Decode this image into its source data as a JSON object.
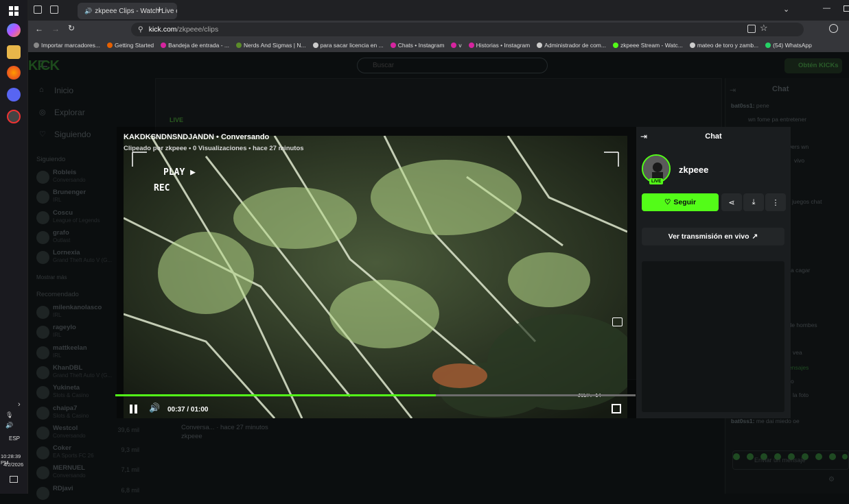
{
  "browser": {
    "tab_title": "zkpeee Clips - Watch Live o",
    "url": "kick.com/zkpeee/clips",
    "url_host": "kick.com",
    "url_path": "/zkpeee/clips",
    "bookmarks": [
      {
        "label": "Importar marcadores...",
        "color": "#888888"
      },
      {
        "label": "Getting Started",
        "color": "#e66000"
      },
      {
        "label": "Bandeja de entrada - ...",
        "color": "#d6249f"
      },
      {
        "label": "Nerds And Sigmas | N...",
        "color": "#5b8c2a"
      },
      {
        "label": "para sacar licencia en ...",
        "color": "#cccccc"
      },
      {
        "label": "Chats • Instagram",
        "color": "#d6249f"
      },
      {
        "label": "v",
        "color": "#d6249f"
      },
      {
        "label": "Historias • Instagram",
        "color": "#d6249f"
      },
      {
        "label": "Administrador de com...",
        "color": "#cccccc"
      },
      {
        "label": "zkpeee Stream - Watc...",
        "color": "#53fc18"
      },
      {
        "label": "mateo de toro y zamb...",
        "color": "#cccccc"
      },
      {
        "label": "(54) WhatsApp",
        "color": "#25d366"
      }
    ]
  },
  "taskbar": {
    "lang": "ESP",
    "time": "10:28:39 PM",
    "date": "4/2/2026"
  },
  "kick": {
    "search_placeholder": "Buscar",
    "get_kicks": "Obtén KICKs",
    "nav": {
      "home": "Inicio",
      "explore": "Explorar",
      "following": "Siguiendo"
    },
    "following_header": "Siguiendo",
    "show_more": "Mostrar más",
    "recommended_header": "Recomendado",
    "following": [
      {
        "name": "Robleis",
        "category": "Conversando"
      },
      {
        "name": "Brunenger",
        "category": "IRL"
      },
      {
        "name": "Coscu",
        "category": "League of Legends"
      },
      {
        "name": "grafo",
        "category": "Outlast"
      },
      {
        "name": "Lornexia",
        "category": "Grand Theft Auto V (G..."
      }
    ],
    "recommended": [
      {
        "name": "milenkanolasco",
        "category": "IRL",
        "viewers": ""
      },
      {
        "name": "rageylo",
        "category": "IRL",
        "viewers": ""
      },
      {
        "name": "mattkeelan",
        "category": "IRL",
        "viewers": ""
      },
      {
        "name": "KhanDBL",
        "category": "Grand Theft Auto V (G...",
        "viewers": ""
      },
      {
        "name": "Yukineta",
        "category": "Slots & Casino",
        "viewers": ""
      },
      {
        "name": "chaipa7",
        "category": "Slots & Casino",
        "viewers": ""
      },
      {
        "name": "Westcol",
        "category": "Conversando",
        "viewers": "39,6 mil"
      },
      {
        "name": "Coker",
        "category": "EA Sports FC 26",
        "viewers": "9,3 mil"
      },
      {
        "name": "MERNUEL",
        "category": "Conversando",
        "viewers": "7,1 mil"
      },
      {
        "name": "RDjavi",
        "category": "",
        "viewers": "6,8 mil"
      }
    ],
    "bg_clip": {
      "badge": "LIVE",
      "meta": "Conversa... · hace 27 minutos",
      "author": "zkpeee"
    },
    "bg_chat": {
      "title": "Chat",
      "messages": [
        {
          "user": "bat0ss1:",
          "text": "pene"
        },
        {
          "user": "",
          "text": "wn fome pa entretener"
        },
        {
          "user": "",
          "text": "wers wn"
        },
        {
          "user": "",
          "text": "vivo"
        },
        {
          "user": "",
          "text": "juegos chat"
        },
        {
          "user": "",
          "text": "o"
        },
        {
          "user": "",
          "text": "a cagar"
        },
        {
          "user": "",
          "text": "s de hombes"
        },
        {
          "user": "",
          "text": "vea"
        },
        {
          "user": "",
          "text": "mensajes"
        },
        {
          "user": "",
          "text": "o"
        },
        {
          "user": "",
          "text": "la foto"
        },
        {
          "user": "bat0ss1:",
          "text": "me dai miedo oe"
        }
      ],
      "input_placeholder": "Enviar un mensaje"
    }
  },
  "clip_modal": {
    "title": "KAKDKSNDNSNDJANDN • Conversando",
    "clipped_by_label": "Clipeado por",
    "clipped_by_user": "zkpeee",
    "meta": "• 0 Visualizaciones • hace 27 minutos",
    "overlay_play": "PLAY ▶",
    "overlay_rec": "REC",
    "overlay_date": "JULY. 14",
    "time": "00:37 / 01:00",
    "progress": 0.6167
  },
  "chat_panel": {
    "title": "Chat",
    "streamer": "zkpeee",
    "live_badge": "LIVE",
    "follow_label": "Seguir",
    "watch_live_label": "Ver transmisión en vivo",
    "accent": "#53fc18"
  }
}
